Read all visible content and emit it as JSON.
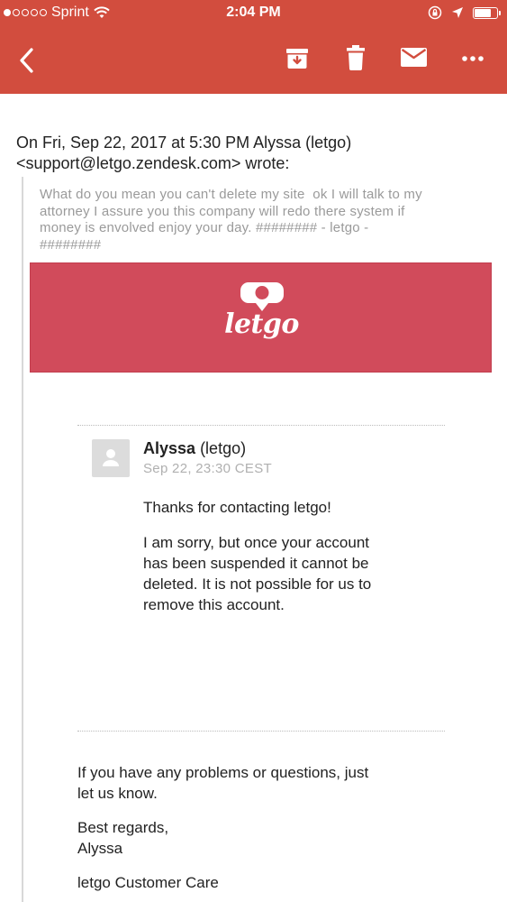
{
  "status_bar": {
    "carrier": "Sprint",
    "time": "2:04 PM",
    "signal_dots_filled": 1,
    "signal_dots_total": 5,
    "battery_level": 0.8
  },
  "toolbar": {
    "back_icon": "chevron-left-icon",
    "archive_icon": "archive-icon",
    "delete_icon": "trash-icon",
    "mark_unread_icon": "envelope-icon",
    "more_icon": "more-icon"
  },
  "email": {
    "reply_header_line1": "On Fri, Sep 22, 2017 at 5:30 PM Alyssa (letgo)",
    "reply_header_line2": "<support@letgo.zendesk.com> wrote:",
    "quoted_line1": "What do you mean you can't delete my site  ok I will talk to my",
    "quoted_line2": "attorney I assure you this company will redo there system if",
    "quoted_line3": "money is envolved enjoy your day. ######## - letgo -",
    "quoted_line4": "########",
    "banner_logo_text": "letgo",
    "message": {
      "sender_name": "Alyssa",
      "sender_org": "(letgo)",
      "date": "Sep 22, 23:30 CEST",
      "para1": "Thanks for contacting letgo!",
      "para2_line1": "I am sorry, but once your account",
      "para2_line2": "has been suspended it cannot be",
      "para2_line3": "deleted. It is not possible for us to",
      "para2_line4": "remove this account."
    },
    "footer": {
      "line1": "If you have any problems or questions, just",
      "line2": "let us know.",
      "regards": "Best regards,",
      "signature": "Alyssa",
      "team": "letgo Customer Care"
    }
  },
  "colors": {
    "toolbar": "#d24d3e",
    "banner": "#d14b5b"
  }
}
